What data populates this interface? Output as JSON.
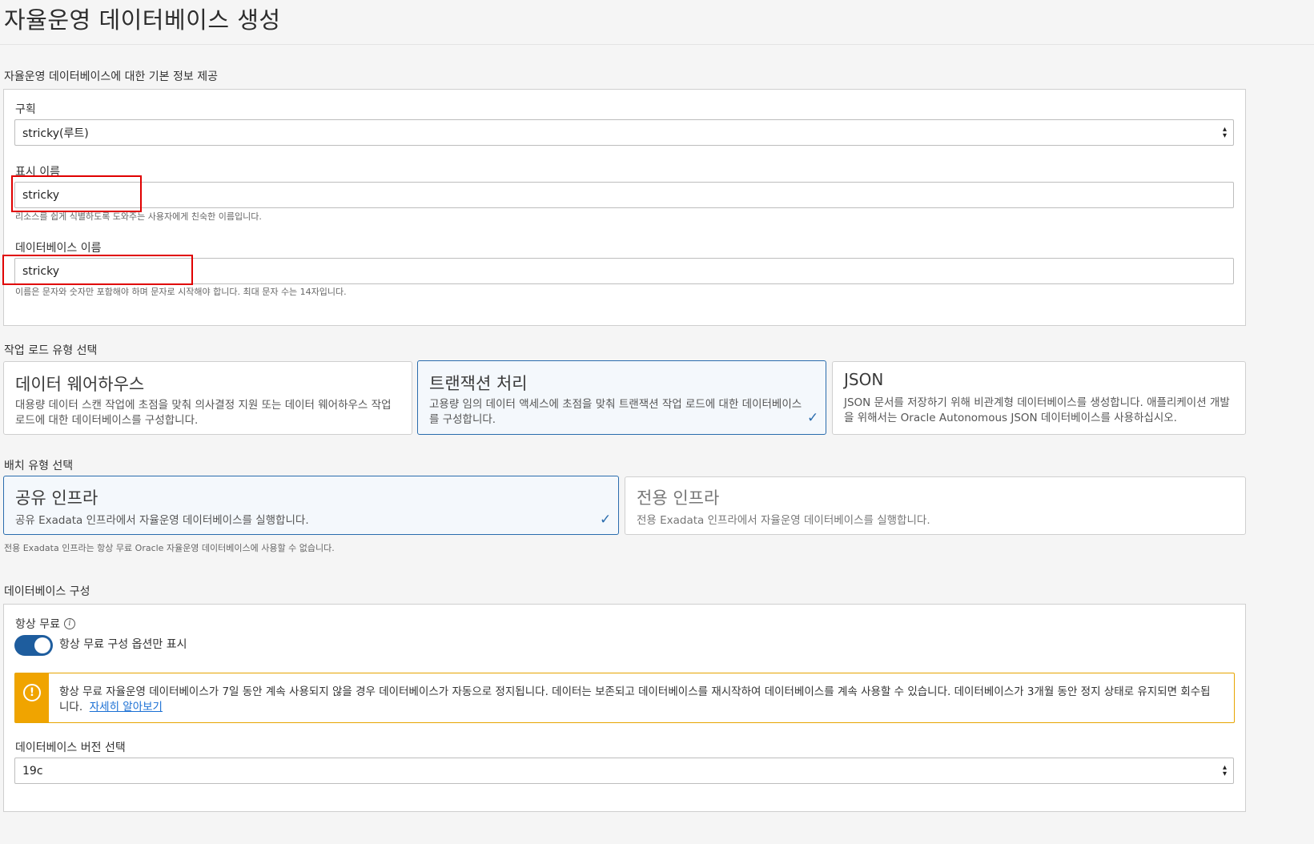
{
  "page": {
    "title": "자율운영 데이터베이스 생성"
  },
  "basic_info": {
    "section_label": "자율운영 데이터베이스에 대한 기본 정보 제공",
    "compartment": {
      "label": "구획",
      "value": "stricky(루트)"
    },
    "display_name": {
      "label": "표시 이름",
      "value": "stricky",
      "helper": "리소스를 쉽게 식별하도록 도와주는 사용자에게 친숙한 이름입니다."
    },
    "db_name": {
      "label": "데이터베이스 이름",
      "value": "stricky",
      "helper": "이름은 문자와 숫자만 포함해야 하며 문자로 시작해야 합니다. 최대 문자 수는 14자입니다."
    }
  },
  "workload": {
    "section_label": "작업 로드 유형 선택",
    "options": [
      {
        "title": "데이터 웨어하우스",
        "desc": "대용량 데이터 스캔 작업에 초점을 맞춰 의사결정 지원 또는 데이터 웨어하우스 작업 로드에 대한 데이터베이스를 구성합니다.",
        "selected": false
      },
      {
        "title": "트랜잭션 처리",
        "desc": "고용량 임의 데이터 액세스에 초점을 맞춰 트랜잭션 작업 로드에 대한 데이터베이스를 구성합니다.",
        "selected": true
      },
      {
        "title": "JSON",
        "desc": "JSON 문서를 저장하기 위해 비관계형 데이터베이스를 생성합니다. 애플리케이션 개발을 위해서는 Oracle Autonomous JSON 데이터베이스를 사용하십시오.",
        "selected": false
      }
    ]
  },
  "deployment": {
    "section_label": "배치 유형 선택",
    "options": [
      {
        "title": "공유 인프라",
        "desc": "공유 Exadata 인프라에서 자율운영 데이터베이스를 실행합니다.",
        "selected": true
      },
      {
        "title": "전용 인프라",
        "desc": "전용 Exadata 인프라에서 자율운영 데이터베이스를 실행합니다.",
        "selected": false
      }
    ],
    "note": "전용 Exadata 인프라는 항상 무료 Oracle 자율운영 데이터베이스에 사용할 수 없습니다."
  },
  "db_config": {
    "section_label": "데이터베이스 구성",
    "always_free_label": "항상 무료",
    "toggle_label": "항상 무료 구성 옵션만 표시",
    "toggle_on": true,
    "warning_text": "항상 무료 자율운영 데이터베이스가 7일 동안 계속 사용되지 않을 경우 데이터베이스가 자동으로 정지됩니다. 데이터는 보존되고 데이터베이스를 재시작하여 데이터베이스를 계속 사용할 수 있습니다. 데이터베이스가 3개월 동안 정지 상태로 유지되면 회수됩니다.",
    "learn_more": "자세히 알아보기",
    "version_label": "데이터베이스 버전 선택",
    "version_value": "19c"
  },
  "colors": {
    "accent": "#2a6cad",
    "toggle": "#1e5d9e",
    "warning": "#f0a400",
    "highlight": "#e00000",
    "link": "#1a6fd4"
  }
}
